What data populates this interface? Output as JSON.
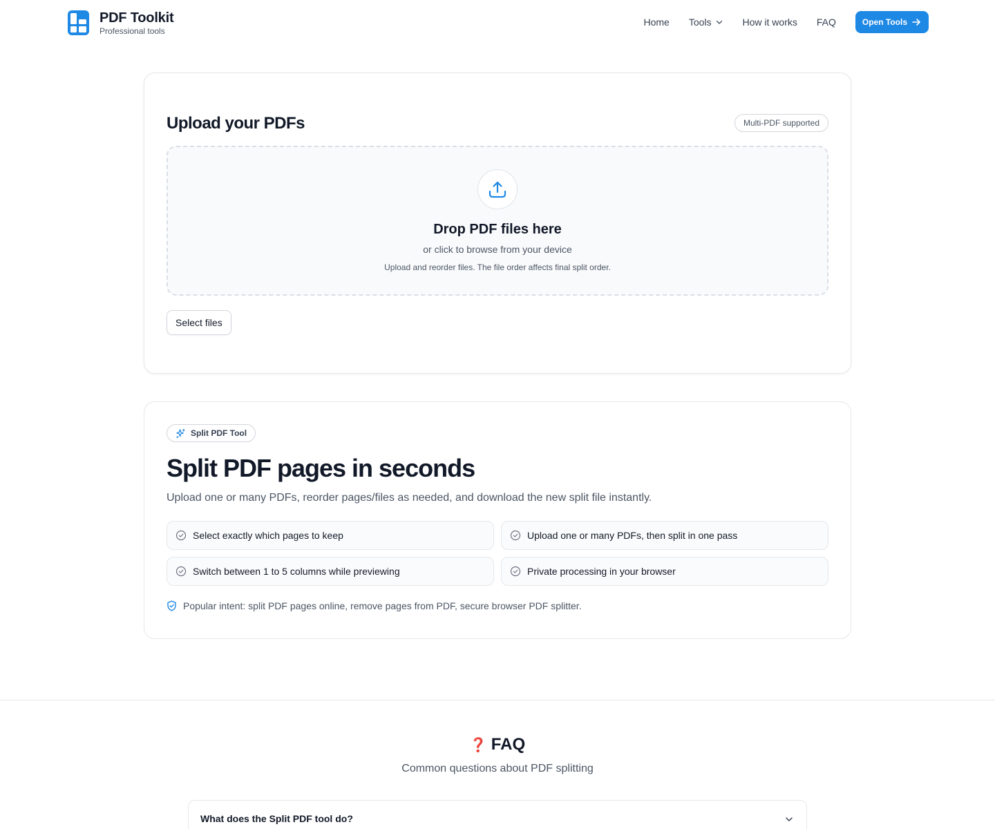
{
  "header": {
    "brand_title": "PDF Toolkit",
    "brand_subtitle": "Professional tools",
    "nav": [
      {
        "label": "Home"
      },
      {
        "label": "Tools"
      },
      {
        "label": "How it works"
      },
      {
        "label": "FAQ"
      }
    ],
    "cta_label": "Open Tools",
    "accent_color": "#1e88e5"
  },
  "upload": {
    "title": "Upload your PDFs",
    "badge": "Multi-PDF supported",
    "dropzone_title": "Drop PDF files here",
    "dropzone_subtitle": "or click to browse from your device",
    "dropzone_hint": "Upload and reorder files. The file order affects final split order.",
    "select_button": "Select files",
    "icon": "upload-icon"
  },
  "split": {
    "badge": "Split PDF Tool",
    "badge_icon": "sparkles-icon",
    "title": "Split PDF pages in seconds",
    "subtitle": "Upload one or many PDFs, reorder pages/files as needed, and download the new split file instantly.",
    "features": [
      {
        "label": "Select exactly which pages to keep"
      },
      {
        "label": "Upload one or many PDFs, then split in one pass"
      },
      {
        "label": "Switch between 1 to 5 columns while previewing"
      },
      {
        "label": "Private processing in your browser"
      }
    ],
    "intent": "Popular intent: split PDF pages online, remove pages from PDF, secure browser PDF splitter."
  },
  "faq": {
    "icon": "❓",
    "title": "FAQ",
    "subtitle": "Common questions about PDF splitting",
    "items": [
      {
        "question": "What does the Split PDF tool do?"
      }
    ]
  }
}
